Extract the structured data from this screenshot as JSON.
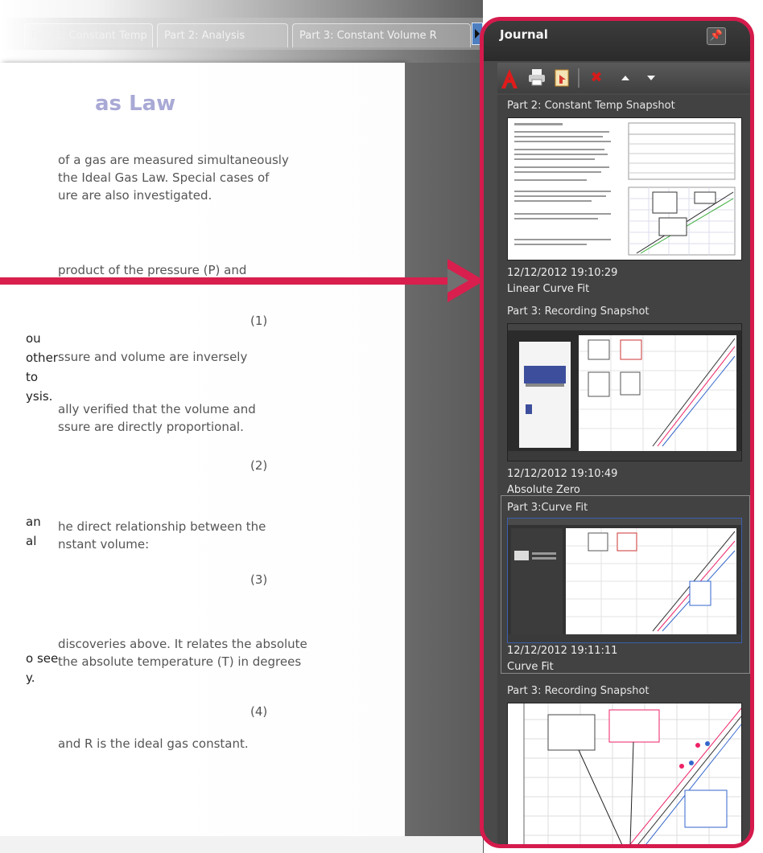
{
  "tabs": [
    {
      "label": "Part 1: Constant Temp"
    },
    {
      "label": "Part 2: Analysis"
    },
    {
      "label": "Part 3: Constant Volume R"
    }
  ],
  "document": {
    "title": "as Law",
    "intro_lines": [
      "of a gas are measured simultaneously",
      "the Ideal Gas Law. Special cases of",
      "ure are also investigated."
    ],
    "para1": "product of the pressure (P) and",
    "eq1": "(1)",
    "para2": "ssure and volume are inversely",
    "para3_lines": [
      "ally verified that the volume and",
      "ssure are directly proportional."
    ],
    "eq2": "(2)",
    "para4_lines": [
      "he direct relationship between the",
      "nstant volume:"
    ],
    "eq3": "(3)",
    "para5_lines": [
      "discoveries above. It relates the absolute",
      "the absolute temperature (T) in degrees"
    ],
    "eq4": "(4)",
    "para6": "and R is the ideal gas constant.",
    "side_lines": [
      "ou",
      "other",
      "to",
      "ysis.",
      "an",
      "al",
      "o see",
      "y."
    ]
  },
  "journal": {
    "title": "Journal",
    "toolbar": {
      "pdf_icon": "pdf-icon",
      "print_icon": "print-icon",
      "export_icon": "export-icon",
      "delete_icon": "delete-icon",
      "up_icon": "move-up-icon",
      "down_icon": "move-down-icon"
    },
    "entries": [
      {
        "title": "Part 2: Constant Temp Snapshot",
        "time": "12/12/2012 19:10:29",
        "note": "Linear Curve Fit"
      },
      {
        "title": "Part 3: Recording Snapshot",
        "time": "12/12/2012 19:10:49",
        "note": "Absolute Zero"
      },
      {
        "title": "Part 3:Curve Fit",
        "time": "12/12/2012 19:11:11",
        "note": "Curve Fit"
      },
      {
        "title": "Part 3: Recording Snapshot",
        "time": "",
        "note": ""
      }
    ]
  },
  "colors": {
    "callout": "#d51a4c",
    "accent_title": "#a9a9d6"
  }
}
